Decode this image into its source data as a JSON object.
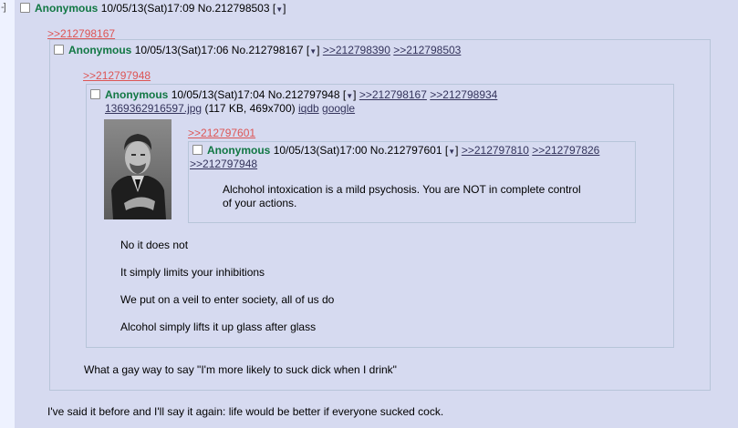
{
  "top_post": {
    "expander": "-]",
    "name": "Anonymous",
    "datetime": "10/05/13(Sat)17:09",
    "number": "No.212798503",
    "menu_arrow": "▼",
    "body": "I've said it before and I'll say it again: life would be better if everyone sucked cock."
  },
  "post_a": {
    "quote_link": ">>212798167",
    "name": "Anonymous",
    "datetime": "10/05/13(Sat)17:06",
    "number": "No.212798167",
    "menu_arrow": "▼",
    "replies": [
      ">>212798390",
      ">>212798503"
    ],
    "body": "What a gay way to say \"I'm more likely to suck dick when I drink\""
  },
  "post_b": {
    "quote_link": ">>212797948",
    "name": "Anonymous",
    "datetime": "10/05/13(Sat)17:04",
    "number": "No.212797948",
    "menu_arrow": "▼",
    "replies": [
      ">>212798167",
      ">>212798934"
    ],
    "file_name": "1369362916597.jpg",
    "file_info": "(117 KB, 469x700)",
    "file_link_1": "iqdb",
    "file_link_2": "google",
    "body_lines": [
      "No it does not",
      "It simply limits your inhibitions",
      "We put on a veil to enter society, all of us do",
      "Alcohol simply lifts it up glass after glass"
    ]
  },
  "post_c": {
    "quote_link": ">>212797601",
    "name": "Anonymous",
    "datetime": "10/05/13(Sat)17:00",
    "number": "No.212797601",
    "menu_arrow": "▼",
    "replies": [
      ">>212797810",
      ">>212797826",
      ">>212797948"
    ],
    "body_lines": [
      "Alchohol intoxication is a mild psychosis. You are NOT in complete control",
      "of your actions."
    ]
  },
  "colors": {
    "name_green": "#117743",
    "link_blue": "#34345c",
    "dead_link_red": "#dd5555",
    "post_bg": "#d6daf0",
    "page_bg": "#eef2ff",
    "border": "#b7c5d9"
  }
}
